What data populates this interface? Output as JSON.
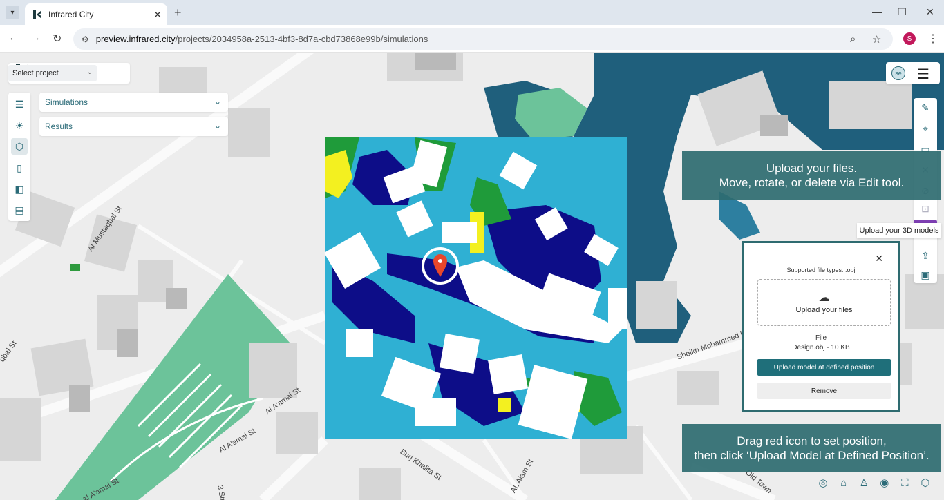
{
  "browser": {
    "tab_title": "Infrared City",
    "url_host": "preview.infrared.city",
    "url_path": "/projects/2034958a-2513-4bf3-8d7a-cbd73868e99b/simulations",
    "profile_initial": "S"
  },
  "app": {
    "select_project": "Select project",
    "user_initials": "se",
    "panels": {
      "simulations": "Simulations",
      "results": "Results"
    },
    "tooltip": "Upload your 3D models",
    "upload": {
      "supported_types": "Supported file types: .obj",
      "dropzone_label": "Upload your files",
      "file_heading": "File",
      "file_name": "Design.obj - 10 KB",
      "primary_button": "Upload model at defined position",
      "remove_button": "Remove"
    },
    "callouts": {
      "top_line1": "Upload your files.",
      "top_line2": "Move, rotate, or delete via Edit tool.",
      "bottom_line1": "Drag red icon to set position,",
      "bottom_line2": "then click ‘Upload Model at Defined Position’."
    },
    "colors": {
      "accent": "#2b6b78",
      "brand_purple": "#7e3fb3",
      "marker_red": "#e8472b",
      "sim_cyan": "#2fb0d3",
      "sim_navy": "#0d0d88",
      "sim_green": "#1f9b3a",
      "sim_yellow": "#f3f020",
      "water": "#1f5f7c",
      "park": "#6cc39a"
    }
  },
  "map": {
    "street_labels": [
      "Al Mustaqbal St",
      "qbal St",
      "Al A'amal St",
      "Al A'amal St",
      "Al A'amal St",
      "Burj Khalifa St",
      "AL Alam St",
      "3 Stre",
      "Sheikh Mohammed b",
      "Old Town"
    ]
  }
}
